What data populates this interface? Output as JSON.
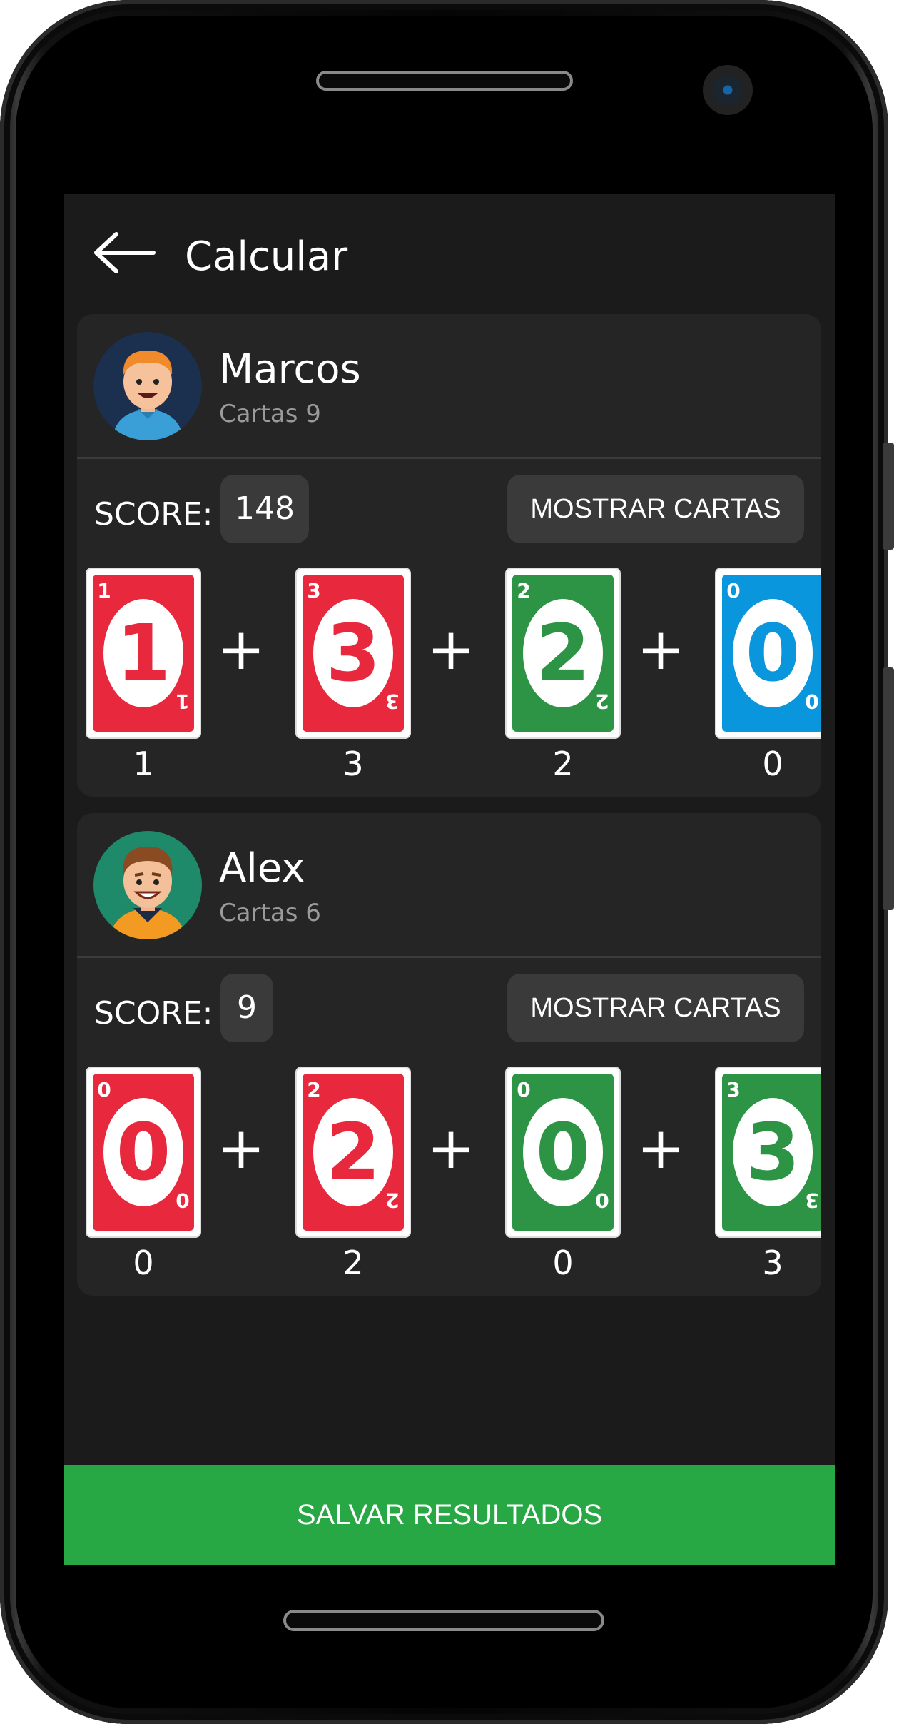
{
  "header": {
    "title": "Calcular",
    "back_icon": "arrow-left-icon"
  },
  "colors": {
    "red": "#e8283c",
    "green": "#2e9445",
    "blue": "#0a96dd",
    "save": "#28a745"
  },
  "players": [
    {
      "name": "Marcos",
      "cards_label": "Cartas 9",
      "score_label": "SCORE:",
      "score": "148",
      "show_cards_label": "MOSTRAR CARTAS",
      "cards": [
        {
          "color": "red",
          "value": "1"
        },
        {
          "color": "red",
          "value": "3"
        },
        {
          "color": "green",
          "value": "2"
        },
        {
          "color": "blue",
          "value": "0"
        }
      ]
    },
    {
      "name": "Alex",
      "cards_label": "Cartas 6",
      "score_label": "SCORE:",
      "score": "9",
      "show_cards_label": "MOSTRAR CARTAS",
      "cards": [
        {
          "color": "red",
          "value": "0"
        },
        {
          "color": "red",
          "value": "2"
        },
        {
          "color": "green",
          "value": "0"
        },
        {
          "color": "green",
          "value": "3"
        }
      ]
    }
  ],
  "plus_symbol": "+",
  "footer": {
    "save_label": "SALVAR RESULTADOS"
  }
}
